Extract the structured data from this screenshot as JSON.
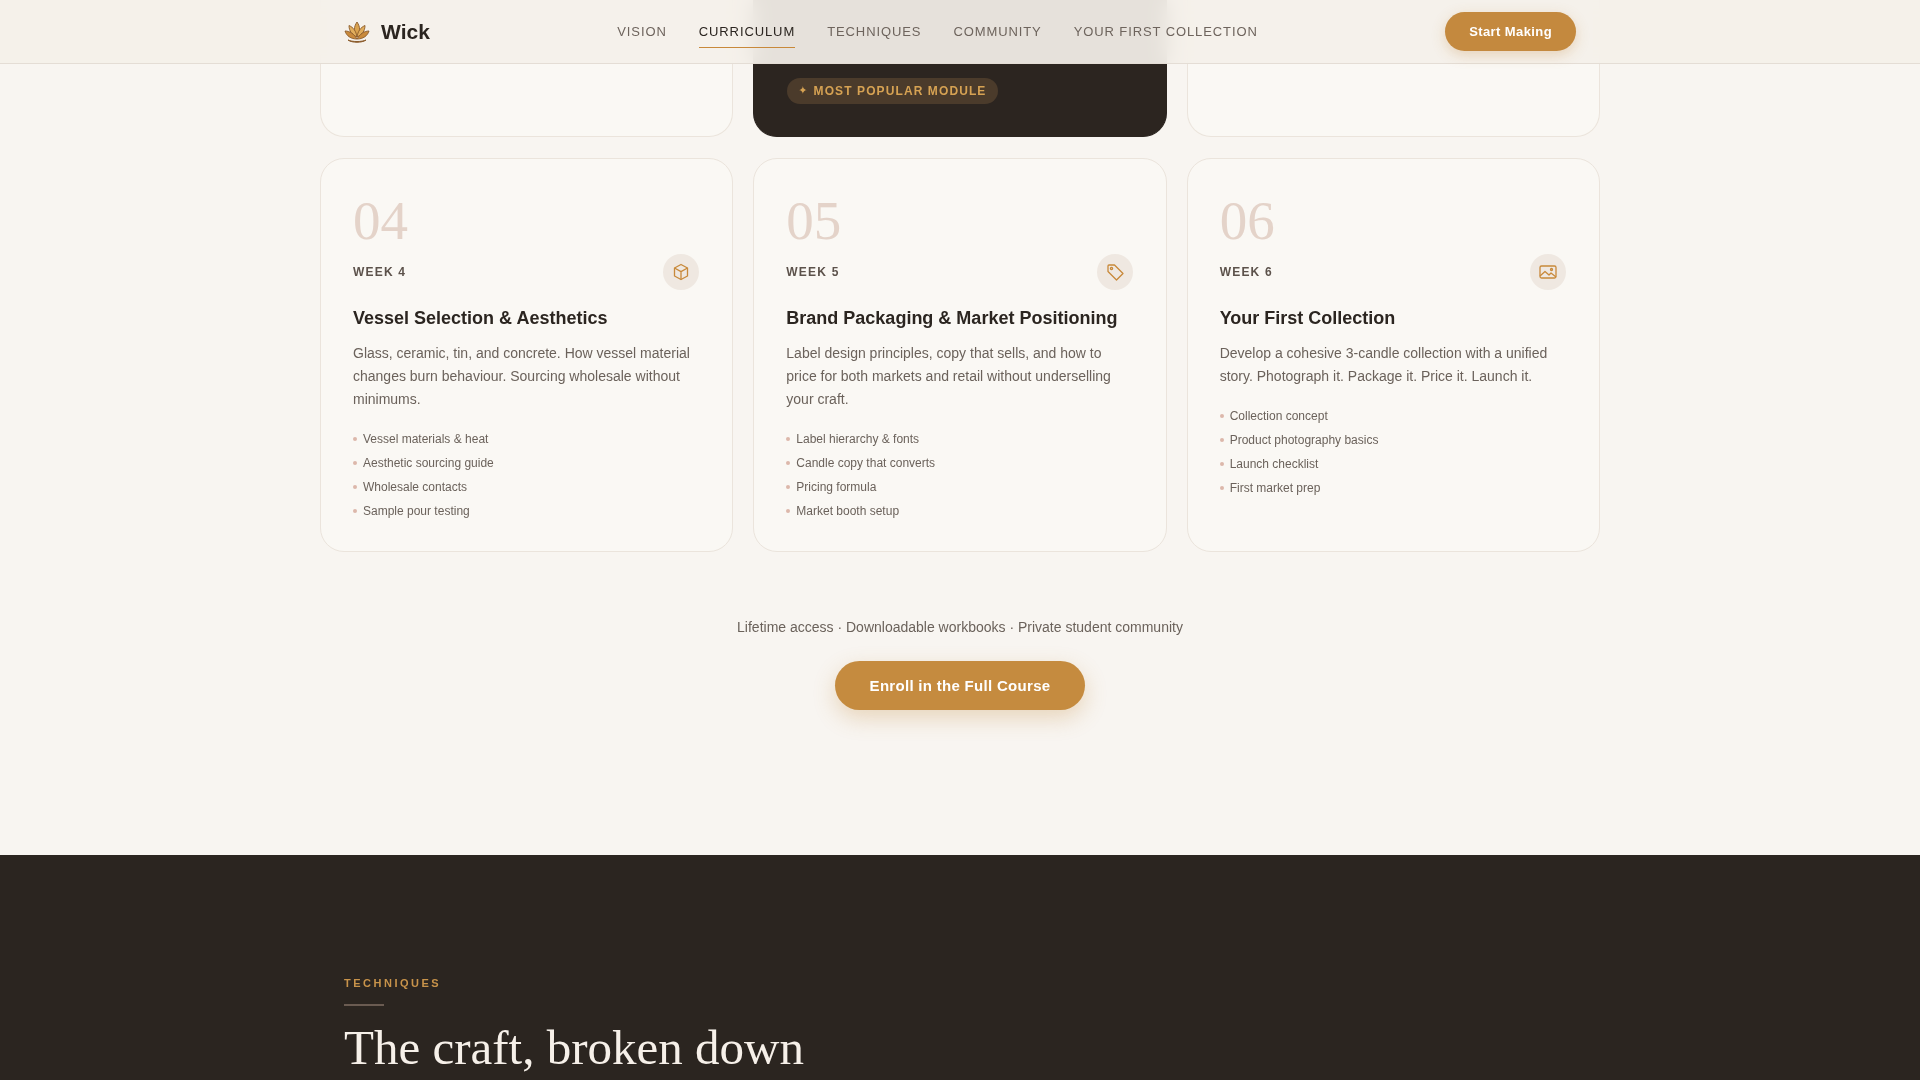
{
  "header": {
    "logo_text": "Wick",
    "nav": [
      {
        "label": "VISION",
        "selected": false
      },
      {
        "label": "CURRICULUM",
        "selected": true
      },
      {
        "label": "TECHNIQUES",
        "selected": false
      },
      {
        "label": "COMMUNITY",
        "selected": false
      },
      {
        "label": "YOUR FIRST COLLECTION",
        "selected": false
      }
    ],
    "cta": "Start Making"
  },
  "modules_above": [
    {
      "featured": false
    },
    {
      "featured": true,
      "badge": {
        "icon": "✦",
        "label": "MOST POPULAR MODULE"
      }
    },
    {
      "featured": false
    }
  ],
  "modules": [
    {
      "number": "04",
      "week": "WEEK 4",
      "title": "Vessel Selection & Aesthetics",
      "description": "Glass, ceramic, tin, and concrete. How vessel material changes burn behaviour. Sourcing wholesale without minimums.",
      "topics": [
        "Vessel materials & heat",
        "Aesthetic sourcing guide",
        "Wholesale contacts",
        "Sample pour testing"
      ]
    },
    {
      "number": "05",
      "week": "WEEK 5",
      "title": "Brand Packaging & Market Positioning",
      "description": "Label design principles, copy that sells, and how to price for both markets and retail without underselling your craft.",
      "topics": [
        "Label hierarchy & fonts",
        "Candle copy that converts",
        "Pricing formula",
        "Market booth setup"
      ]
    },
    {
      "number": "06",
      "week": "WEEK 6",
      "title": "Your First Collection",
      "description": "Develop a cohesive 3-candle collection with a unified story. Photograph it. Package it. Price it. Launch it.",
      "topics": [
        "Collection concept",
        "Product photography basics",
        "Launch checklist",
        "First market prep"
      ]
    }
  ],
  "enroll": {
    "perks": "Lifetime access · Downloadable workbooks · Private student community",
    "button": "Enroll in the Full Course"
  },
  "techniques": {
    "eyebrow": "TECHNIQUES",
    "heading": "The craft, broken down"
  }
}
